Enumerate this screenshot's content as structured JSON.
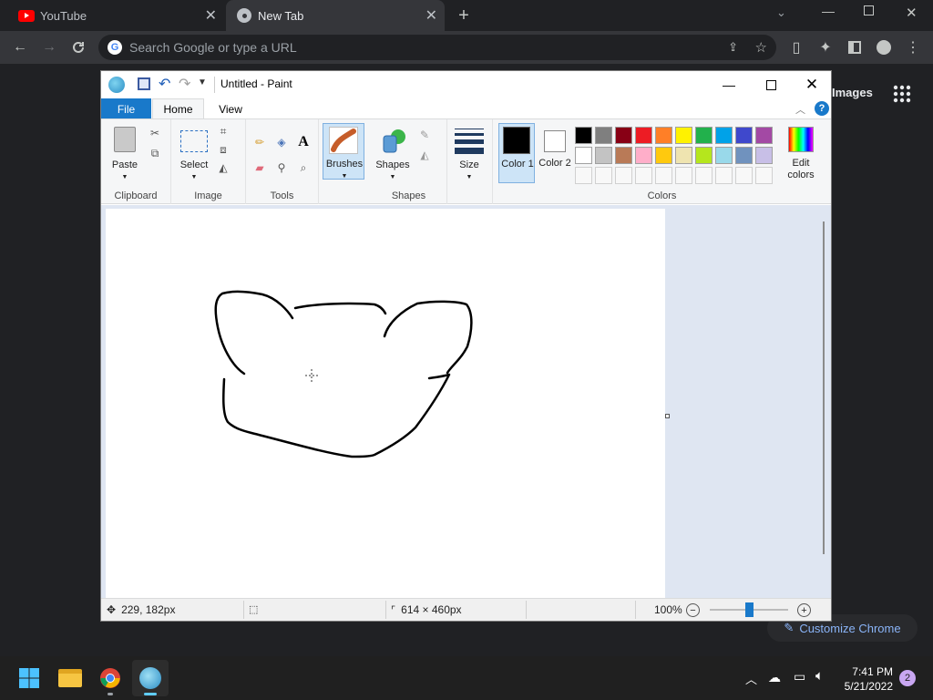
{
  "chrome": {
    "tabs": [
      {
        "title": "YouTube"
      },
      {
        "title": "New Tab"
      }
    ],
    "omnibox_placeholder": "Search Google or type a URL",
    "new_tab_page": {
      "images_link": "Images",
      "customize_label": "Customize Chrome"
    }
  },
  "paint": {
    "title": "Untitled - Paint",
    "ribbon_tabs": [
      "File",
      "Home",
      "View"
    ],
    "groups": {
      "clipboard": {
        "label": "Clipboard",
        "paste": "Paste"
      },
      "image": {
        "label": "Image",
        "select": "Select"
      },
      "tools": {
        "label": "Tools"
      },
      "brushes": {
        "label": "Brushes"
      },
      "shapes": {
        "label": "Shapes",
        "shapes_button": "Shapes"
      },
      "size": {
        "label": "Size"
      },
      "colors": {
        "label": "Colors",
        "color1": "Color 1",
        "color2": "Color 2",
        "edit_colors": "Edit colors",
        "color1_value": "#000000",
        "color2_value": "#ffffff",
        "palette_row1": [
          "#000000",
          "#7f7f7f",
          "#880015",
          "#ed1c24",
          "#ff7f27",
          "#fff200",
          "#22b14c",
          "#00a2e8",
          "#3f48cc",
          "#a349a4"
        ],
        "palette_row2": [
          "#ffffff",
          "#c3c3c3",
          "#b97a57",
          "#ffaec9",
          "#ffc90e",
          "#efe4b0",
          "#b5e61d",
          "#99d9ea",
          "#7092be",
          "#c8bfe7"
        ]
      }
    },
    "status": {
      "cursor_pos": "229, 182px",
      "image_size": "614 × 460px",
      "zoom": "100%",
      "zoom_level": 0.5
    }
  },
  "taskbar": {
    "time": "7:41 PM",
    "date": "5/21/2022",
    "notification_count": "2"
  }
}
